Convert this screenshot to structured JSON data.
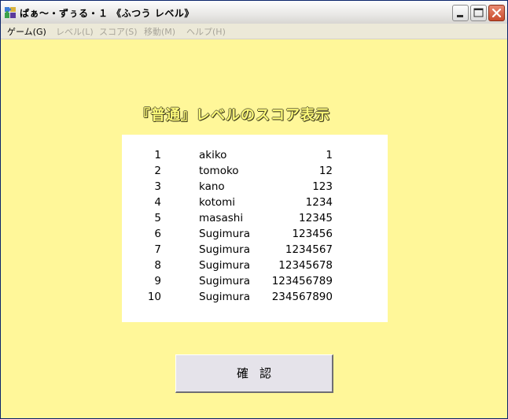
{
  "window": {
    "title": "ぱぁ〜・ずぅる・１ 《ふつう レベル》"
  },
  "menu": {
    "items": [
      {
        "label": "ゲーム(G)",
        "enabled": true
      },
      {
        "label": "レベル(L)",
        "enabled": false
      },
      {
        "label": "スコア(S)",
        "enabled": false
      },
      {
        "label": "移動(M)",
        "enabled": false
      },
      {
        "label": "ヘルプ(H)",
        "enabled": false
      }
    ]
  },
  "heading": "『普通』レベルのスコア表示",
  "scores": [
    {
      "rank": "1",
      "name": "akiko",
      "score": "1"
    },
    {
      "rank": "2",
      "name": "tomoko",
      "score": "12"
    },
    {
      "rank": "3",
      "name": "kano",
      "score": "123"
    },
    {
      "rank": "4",
      "name": "kotomi",
      "score": "1234"
    },
    {
      "rank": "5",
      "name": "masashi",
      "score": "12345"
    },
    {
      "rank": "6",
      "name": "Sugimura",
      "score": "123456"
    },
    {
      "rank": "7",
      "name": "Sugimura",
      "score": "1234567"
    },
    {
      "rank": "8",
      "name": "Sugimura",
      "score": "12345678"
    },
    {
      "rank": "9",
      "name": "Sugimura",
      "score": "123456789"
    },
    {
      "rank": "10",
      "name": "Sugimura",
      "score": "234567890"
    }
  ],
  "confirm_label": "確認",
  "icons": {
    "app": "puzzle-app-icon",
    "minimize": "minimize-icon",
    "maximize": "maximize-icon",
    "close": "close-icon"
  },
  "colors": {
    "background": "#fff799",
    "panel": "#ffffff",
    "heading": "#fffb7a",
    "close_button": "#c94b2c"
  }
}
